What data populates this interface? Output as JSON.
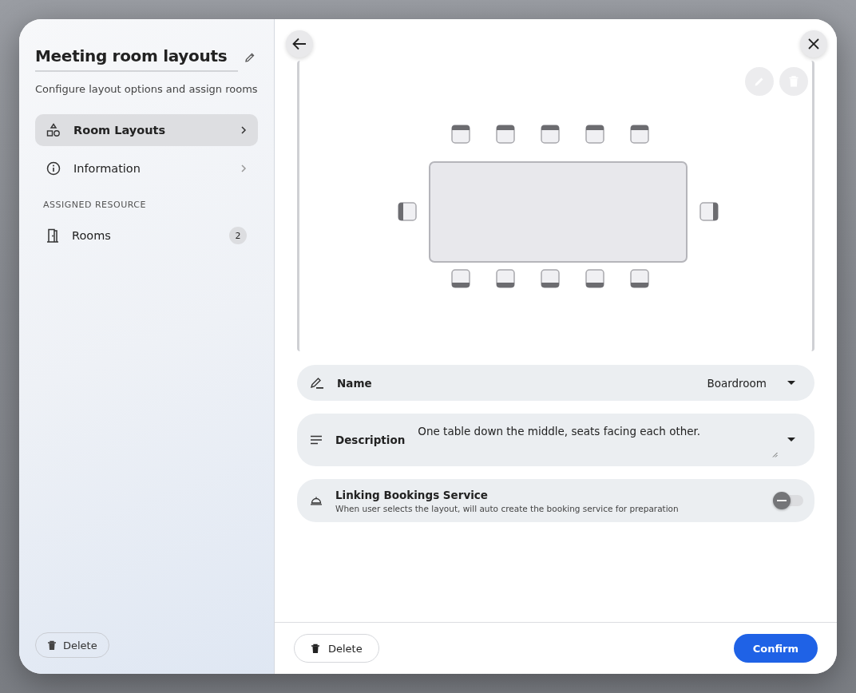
{
  "sidebar": {
    "title": "Meeting room layouts",
    "subtitle": "Configure layout options and assign rooms",
    "items": [
      {
        "kind": "nav",
        "label": "Room Layouts",
        "selected": true
      },
      {
        "kind": "nav",
        "label": "Information",
        "selected": false
      },
      {
        "kind": "section",
        "label": "ASSIGNED RESOURCE"
      },
      {
        "kind": "nav",
        "label": "Rooms",
        "selected": false,
        "count": "2"
      }
    ],
    "delete_button": "Delete"
  },
  "editor": {
    "fields": [
      {
        "kind": "select",
        "label": "Name",
        "value": "Boardroom"
      },
      {
        "kind": "textarea",
        "label": "Description",
        "value": "One table down the middle, seats facing each other."
      },
      {
        "kind": "toggle",
        "label": "Linking Bookings Service",
        "description": "When user selects the layout, will auto create the booking service for preparation",
        "on": false
      }
    ],
    "delete_button": "Delete",
    "confirm_button": "Confirm"
  }
}
